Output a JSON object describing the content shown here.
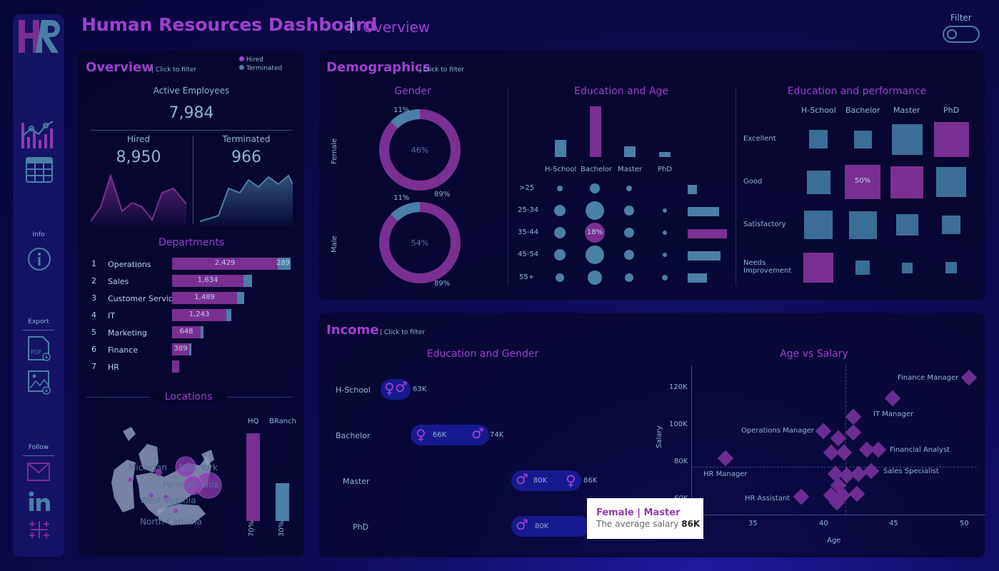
{
  "header": {
    "title": "Human Resources Dashboard",
    "separator": "|",
    "subtitle": "Overview",
    "filter_label": "Filter"
  },
  "sidebar": {
    "logo": "HR",
    "info_label": "Info",
    "export_label": "Export",
    "follow_label": "Follow",
    "icons": [
      "dashboard-icon",
      "table-icon",
      "info-icon",
      "pdf-export-icon",
      "image-export-icon",
      "gmail-icon",
      "linkedin-icon",
      "tableau-icon"
    ]
  },
  "overview": {
    "title": "Overview",
    "hint": "Click to filter",
    "legend": {
      "hired": "Hired",
      "terminated": "Terminated"
    },
    "active_label": "Active Employees",
    "active_value": "7,984",
    "hired_label": "Hired",
    "hired_value": "8,950",
    "terminated_label": "Terminated",
    "terminated_value": "966",
    "departments_title": "Departments",
    "departments": [
      {
        "rank": "1",
        "name": "Operations",
        "hired": "2,429",
        "terminated": "289",
        "hired_n": 2429,
        "terminated_n": 289
      },
      {
        "rank": "2",
        "name": "Sales",
        "hired": "1,634",
        "terminated": "",
        "hired_n": 1634,
        "terminated_n": 190
      },
      {
        "rank": "3",
        "name": "Customer Service",
        "hired": "1,489",
        "terminated": "",
        "hired_n": 1489,
        "terminated_n": 170
      },
      {
        "rank": "4",
        "name": "IT",
        "hired": "1,243",
        "terminated": "",
        "hired_n": 1243,
        "terminated_n": 120
      },
      {
        "rank": "5",
        "name": "Marketing",
        "hired": "648",
        "terminated": "",
        "hired_n": 648,
        "terminated_n": 70
      },
      {
        "rank": "6",
        "name": "Finance",
        "hired": "389",
        "terminated": "",
        "hired_n": 389,
        "terminated_n": 50
      },
      {
        "rank": "7",
        "name": "HR",
        "hired": "",
        "terminated": "",
        "hired_n": 160,
        "terminated_n": 0
      }
    ],
    "locations_title": "Locations",
    "map_labels": [
      "Michigan",
      "New York",
      "Pennsylvania",
      "West Virginia",
      "North Carolina"
    ],
    "hq_label": "HQ",
    "branch_label": "BRanch",
    "hq_pct": "70%",
    "branch_pct": "30%",
    "hq_share": 0.7,
    "branch_share": 0.3
  },
  "demographics": {
    "title": "Demographics",
    "hint": "Click to filter",
    "gender_title": "Gender",
    "female_label": "Female",
    "male_label": "Male",
    "female_center": "46%",
    "female_small": "11%",
    "female_big": "89%",
    "male_center": "54%",
    "male_small": "11%",
    "male_big": "89%",
    "edu_age_title": "Education and Age",
    "edu_levels": [
      "H-School",
      "Bachelor",
      "Master",
      "PhD"
    ],
    "age_groups": [
      ">25",
      "25-34",
      "35-44",
      "45-54",
      "55+"
    ],
    "highlight_bubble": "18%",
    "edu_perf_title": "Education and performance",
    "perf_levels": [
      "Excellent",
      "Good",
      "Satisfactory",
      "Needs Improvement"
    ],
    "highlight_square": "50%"
  },
  "income": {
    "title": "Income",
    "hint": "Click to filter",
    "edu_gender_title": "Education and Gender",
    "rows": [
      {
        "level": "H-School",
        "female": "",
        "male": "63K"
      },
      {
        "level": "Bachelor",
        "female": "66K",
        "male": "74K"
      },
      {
        "level": "Master",
        "female": "86K",
        "male": "80K"
      },
      {
        "level": "PhD",
        "female": "",
        "male": "80K"
      }
    ],
    "scatter_title": "Age vs Salary",
    "y_label": "Salary",
    "x_label": "Age",
    "y_ticks": [
      "120K",
      "100K",
      "80K",
      "60K"
    ],
    "x_ticks": [
      "35",
      "40",
      "45",
      "50"
    ],
    "job_labels": [
      "Finance Manager",
      "IT Manager",
      "Operations Manager",
      "Financial Analyst",
      "HR Manager",
      "Sales Specialist",
      "HR Assistant"
    ],
    "tooltip": {
      "title": "Female | Master",
      "text": "The average salary",
      "value": "86K"
    }
  },
  "colors": {
    "purple": "#a040d0",
    "bar_purple": "#7a2f92",
    "steel": "#4a7fa8",
    "text": "#8fb3d6"
  }
}
